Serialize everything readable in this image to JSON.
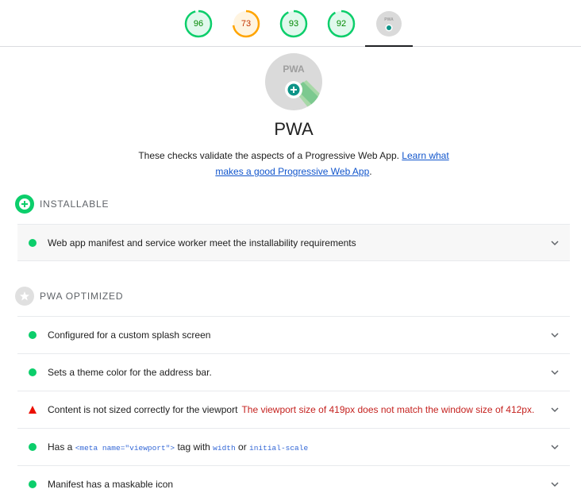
{
  "gauges": [
    {
      "name": "performance",
      "score": "96",
      "fraction": 0.96,
      "color": "#0cce6b"
    },
    {
      "name": "accessibility",
      "score": "73",
      "fraction": 0.73,
      "color": "#ffa400"
    },
    {
      "name": "best-practices",
      "score": "93",
      "fraction": 0.93,
      "color": "#0cce6b"
    },
    {
      "name": "seo",
      "score": "92",
      "fraction": 0.92,
      "color": "#0cce6b"
    },
    {
      "name": "pwa",
      "score": "",
      "fraction": 0,
      "color": "#0cce6b"
    }
  ],
  "pwa": {
    "badge_text": "PWA",
    "title": "PWA",
    "description": "These checks validate the aspects of a Progressive Web App.",
    "link_text": "Learn what makes a good Progressive Web App",
    "suffix": "."
  },
  "groups": {
    "installable": {
      "label": "INSTALLABLE",
      "audits": [
        {
          "status": "pass",
          "title": "Web app manifest and service worker meet the installability requirements"
        }
      ]
    },
    "optimized": {
      "label": "PWA OPTIMIZED",
      "audits": [
        {
          "status": "pass",
          "title": "Configured for a custom splash screen"
        },
        {
          "status": "pass",
          "title": "Sets a theme color for the address bar."
        },
        {
          "status": "fail",
          "title": "Content is not sized correctly for the viewport",
          "display": "The viewport size of 419px does not match the window size of 412px."
        },
        {
          "status": "pass",
          "title_prefix": "Has a",
          "code_tag": "<meta name=\"viewport\">",
          "title_mid": "tag with",
          "code_width": "width",
          "title_or": "or",
          "code_scale": "initial-scale"
        },
        {
          "status": "pass",
          "title": "Manifest has a maskable icon"
        }
      ]
    }
  },
  "colors": {
    "pass": "#0cce6b",
    "average": "#ffa400",
    "fail": "#eb0f00",
    "link": "#1155cc"
  }
}
